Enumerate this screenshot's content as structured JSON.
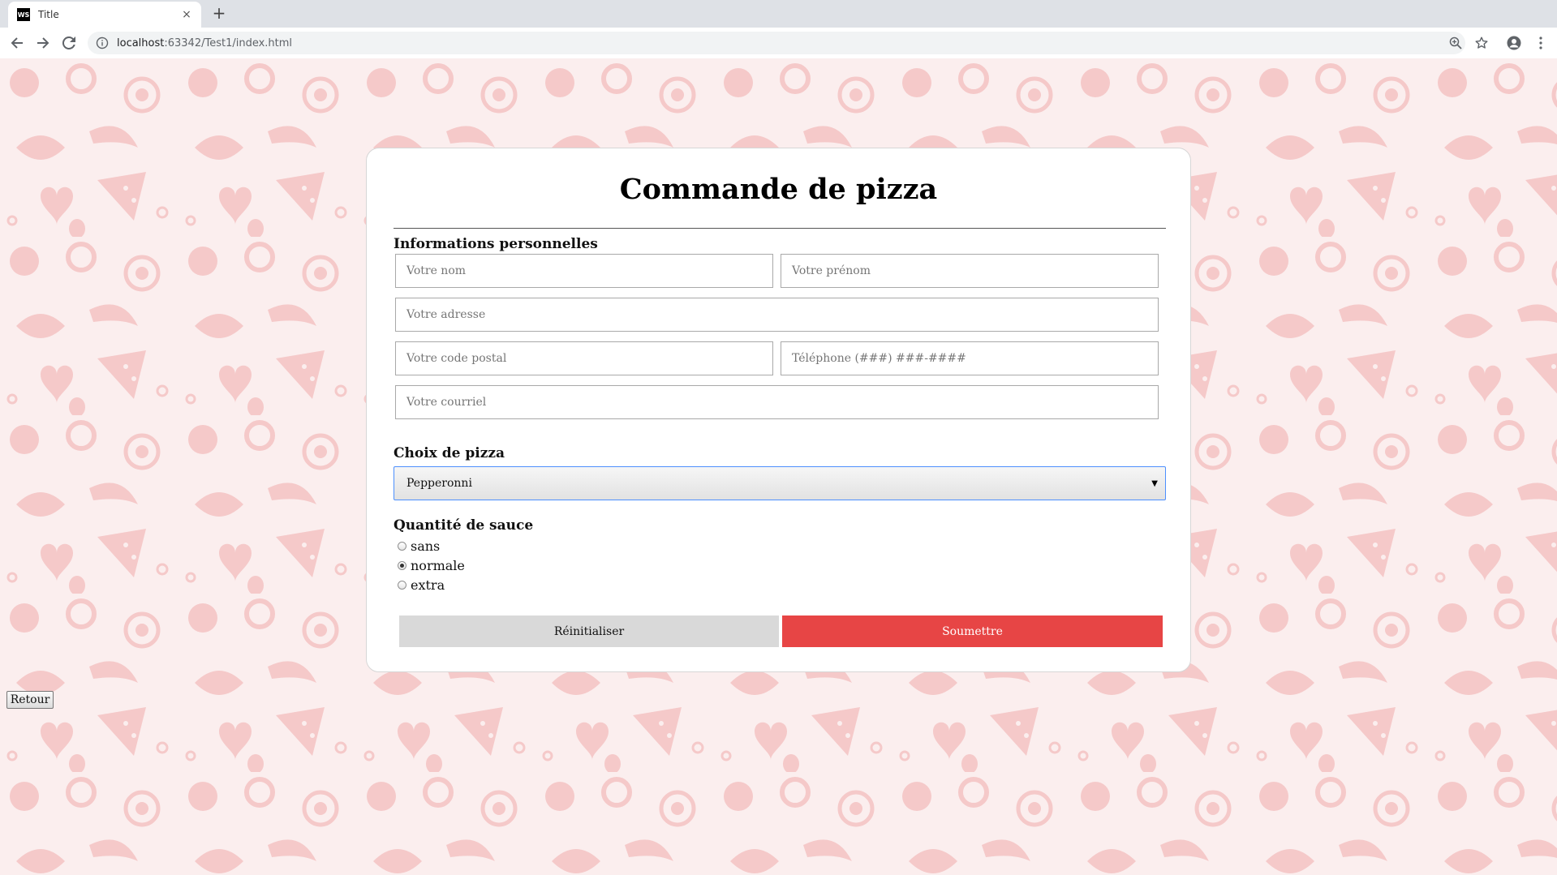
{
  "browser": {
    "tab_title": "Title",
    "tab_favicon_text": "WS",
    "close_glyph": "×",
    "newtab_glyph": "+",
    "url_host": "localhost",
    "url_rest": ":63342/Test1/index.html"
  },
  "form": {
    "title": "Commande de pizza",
    "personal_section_label": "Informations personnelles",
    "placeholders": {
      "nom": "Votre nom",
      "prenom": "Votre prénom",
      "adresse": "Votre adresse",
      "code_postal": "Votre code postal",
      "telephone": "Téléphone (###) ###-####",
      "courriel": "Votre courriel"
    },
    "pizza_section_label": "Choix de pizza",
    "pizza_selected": "Pepperonni",
    "select_arrow": "▼",
    "sauce_section_label": "Quantité de sauce",
    "sauce_options": [
      "sans",
      "normale",
      "extra"
    ],
    "sauce_selected": "normale",
    "reset_label": "Réinitialiser",
    "submit_label": "Soumettre"
  },
  "retour_label": "Retour",
  "colors": {
    "submit": "#e74545",
    "reset": "#d9d9d9",
    "pattern": "#f5c9c9",
    "page_bg": "#fbeeee"
  }
}
